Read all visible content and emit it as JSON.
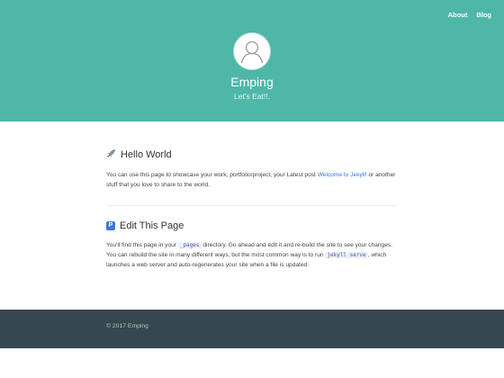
{
  "nav": {
    "about": "About",
    "blog": "Blog"
  },
  "site": {
    "title": "Emping",
    "tagline": "Let's Eat!!."
  },
  "posts": [
    {
      "icon": "rocket-icon",
      "title": "Hello World",
      "body_before": "You can use this page to showcase your work, portfolio/project, your Latest post ",
      "link": "Welcome to Jekyll!",
      "body_after": " or another stuff that you love to share to the world."
    },
    {
      "icon": "p-icon",
      "icon_text": "P",
      "title": "Edit This Page",
      "text1": "You'll find this page in your ",
      "code1": "_pages",
      "text2": " directory. Go ahead and edit it and re-build the site to see your changes. You can rebuild the site in many different ways, but the most common way is to run ",
      "code2": "jekyll serve",
      "text3": ", which launches a web server and auto-regenerates your site when a file is updated."
    }
  ],
  "footer": {
    "text": "© 2017 Emping"
  },
  "colors": {
    "header": "#4fb7a8",
    "footer": "#37474f",
    "link": "#2a7ae2"
  }
}
